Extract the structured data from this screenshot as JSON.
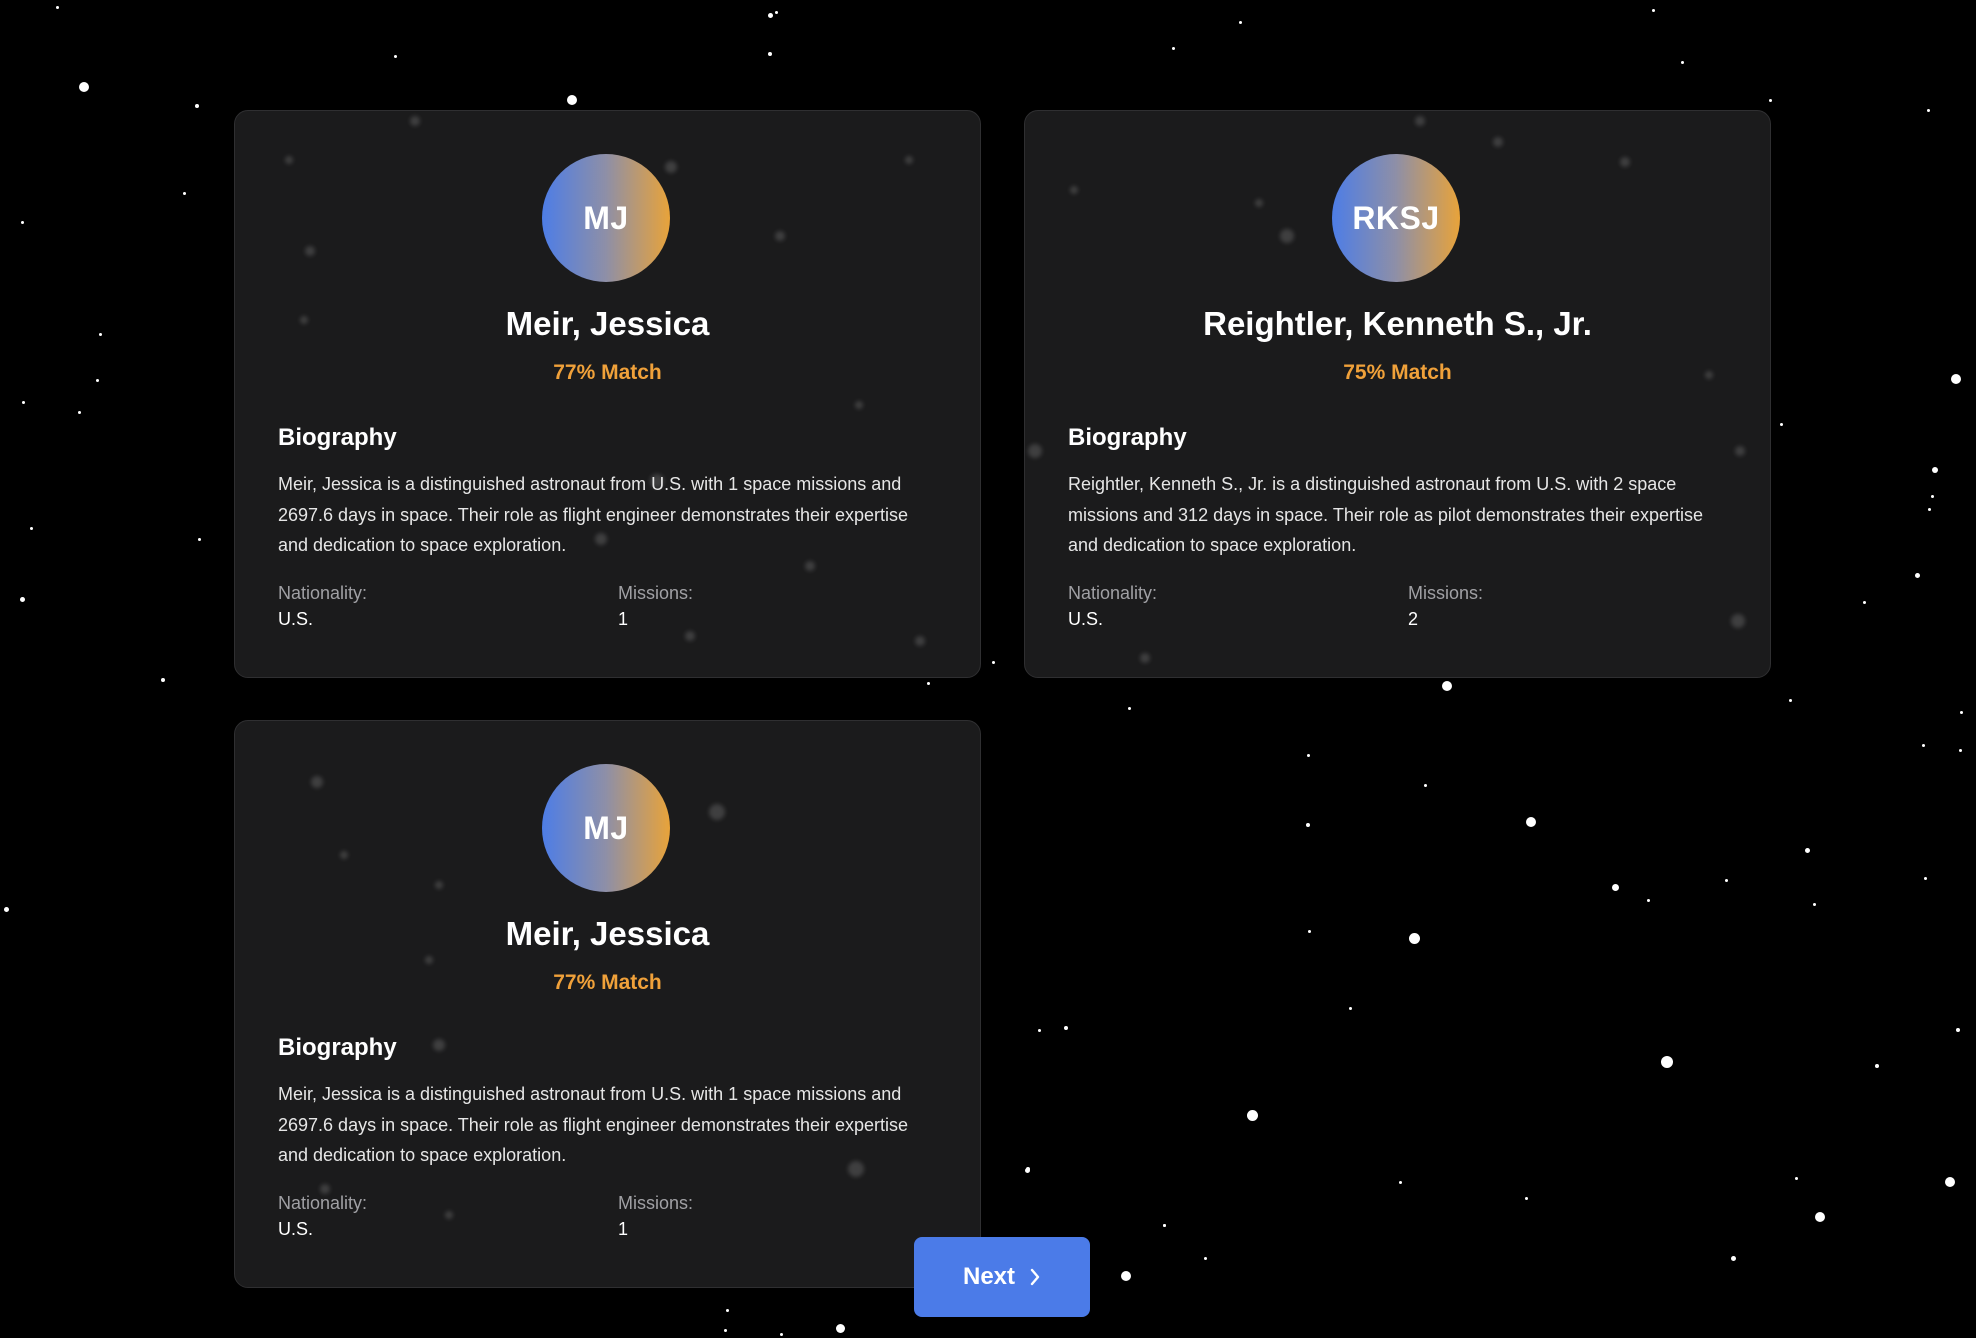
{
  "cards": [
    {
      "initials": "MJ",
      "name": "Meir, Jessica",
      "match": "77% Match",
      "bio_heading": "Biography",
      "bio": "Meir, Jessica is a distinguished astronaut from U.S. with 1 space missions and 2697.6 days in space. Their role as flight engineer demonstrates their expertise and dedication to space exploration.",
      "nationality_label": "Nationality:",
      "nationality": "U.S.",
      "missions_label": "Missions:",
      "missions": "1"
    },
    {
      "initials": "RKSJ",
      "name": "Reightler, Kenneth S., Jr.",
      "match": "75% Match",
      "bio_heading": "Biography",
      "bio": "Reightler, Kenneth S., Jr. is a distinguished astronaut from U.S. with 2 space missions and 312 days in space. Their role as pilot demonstrates their expertise and dedication to space exploration.",
      "nationality_label": "Nationality:",
      "nationality": "U.S.",
      "missions_label": "Missions:",
      "missions": "2"
    },
    {
      "initials": "MJ",
      "name": "Meir, Jessica",
      "match": "77% Match",
      "bio_heading": "Biography",
      "bio": "Meir, Jessica is a distinguished astronaut from U.S. with 1 space missions and 2697.6 days in space. Their role as flight engineer demonstrates their expertise and dedication to space exploration.",
      "nationality_label": "Nationality:",
      "nationality": "U.S.",
      "missions_label": "Missions:",
      "missions": "1"
    }
  ],
  "next_button": {
    "label": "Next",
    "icon": "chevron-right-icon"
  },
  "colors": {
    "background": "#000000",
    "card": "#1b1b1c",
    "accent": "#f0a13a",
    "button": "#4b7be8",
    "avatar_gradient_start": "#4d7de6",
    "avatar_gradient_end": "#e8a33a"
  }
}
